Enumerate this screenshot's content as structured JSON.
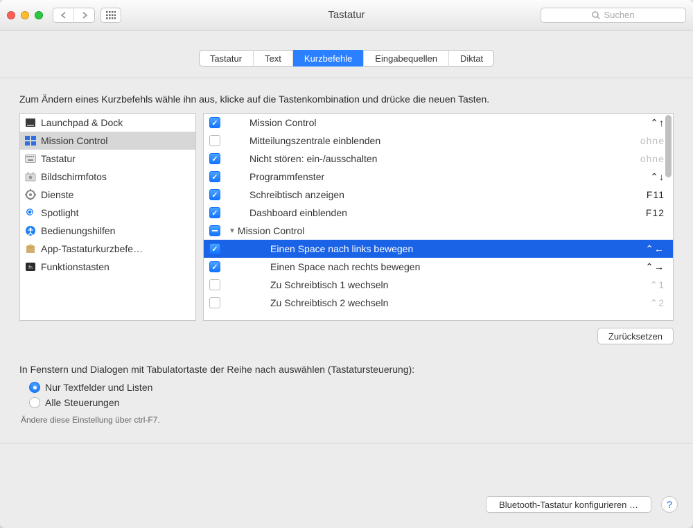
{
  "window_title": "Tastatur",
  "search_placeholder": "Suchen",
  "tabs": [
    {
      "label": "Tastatur"
    },
    {
      "label": "Text"
    },
    {
      "label": "Kurzbefehle",
      "active": true
    },
    {
      "label": "Eingabequellen"
    },
    {
      "label": "Diktat"
    }
  ],
  "instruction": "Zum Ändern eines Kurzbefehls wähle ihn aus, klicke auf die Tastenkombination und drücke die neuen Tasten.",
  "categories": [
    {
      "label": "Launchpad & Dock"
    },
    {
      "label": "Mission Control",
      "selected": true
    },
    {
      "label": "Tastatur"
    },
    {
      "label": "Bildschirmfotos"
    },
    {
      "label": "Dienste"
    },
    {
      "label": "Spotlight"
    },
    {
      "label": "Bedienungshilfen"
    },
    {
      "label": "App-Tastaturkurzbefe…"
    },
    {
      "label": "Funktionstasten"
    }
  ],
  "shortcuts": [
    {
      "checked": true,
      "label": "Mission Control",
      "shortcut": "⌃↑",
      "indent": 1
    },
    {
      "checked": false,
      "label": "Mitteilungszentrale einblenden",
      "shortcut": "ohne",
      "indent": 1,
      "dim": true
    },
    {
      "checked": true,
      "label": "Nicht stören: ein-/ausschalten",
      "shortcut": "ohne",
      "indent": 1,
      "dim": true
    },
    {
      "checked": true,
      "label": "Programmfenster",
      "shortcut": "⌃↓",
      "indent": 1
    },
    {
      "checked": true,
      "label": "Schreibtisch anzeigen",
      "shortcut": "F11",
      "indent": 1
    },
    {
      "checked": true,
      "label": "Dashboard einblenden",
      "shortcut": "F12",
      "indent": 1
    },
    {
      "checked": "mixed",
      "label": "Mission Control",
      "group": true,
      "indent": 0
    },
    {
      "checked": true,
      "label": "Einen Space nach links bewegen",
      "shortcut": "⌃←",
      "indent": 2,
      "selected": true
    },
    {
      "checked": true,
      "label": "Einen Space nach rechts bewegen",
      "shortcut": "⌃→",
      "indent": 2
    },
    {
      "checked": false,
      "label": "Zu Schreibtisch 1 wechseln",
      "shortcut": "⌃1",
      "indent": 2,
      "dim": true
    },
    {
      "checked": false,
      "label": "Zu Schreibtisch 2 wechseln",
      "shortcut": "⌃2",
      "indent": 2,
      "dim": true
    }
  ],
  "reset_label": "Zurücksetzen",
  "radio_title": "In Fenstern und Dialogen mit Tabulatortaste der Reihe nach auswählen (Tastatursteuerung):",
  "radio_opt1": "Nur Textfelder und Listen",
  "radio_opt2": "Alle Steuerungen",
  "radio_hint": "Ändere diese Einstellung über ctrl-F7.",
  "bottom_button": "Bluetooth-Tastatur konfigurieren …"
}
